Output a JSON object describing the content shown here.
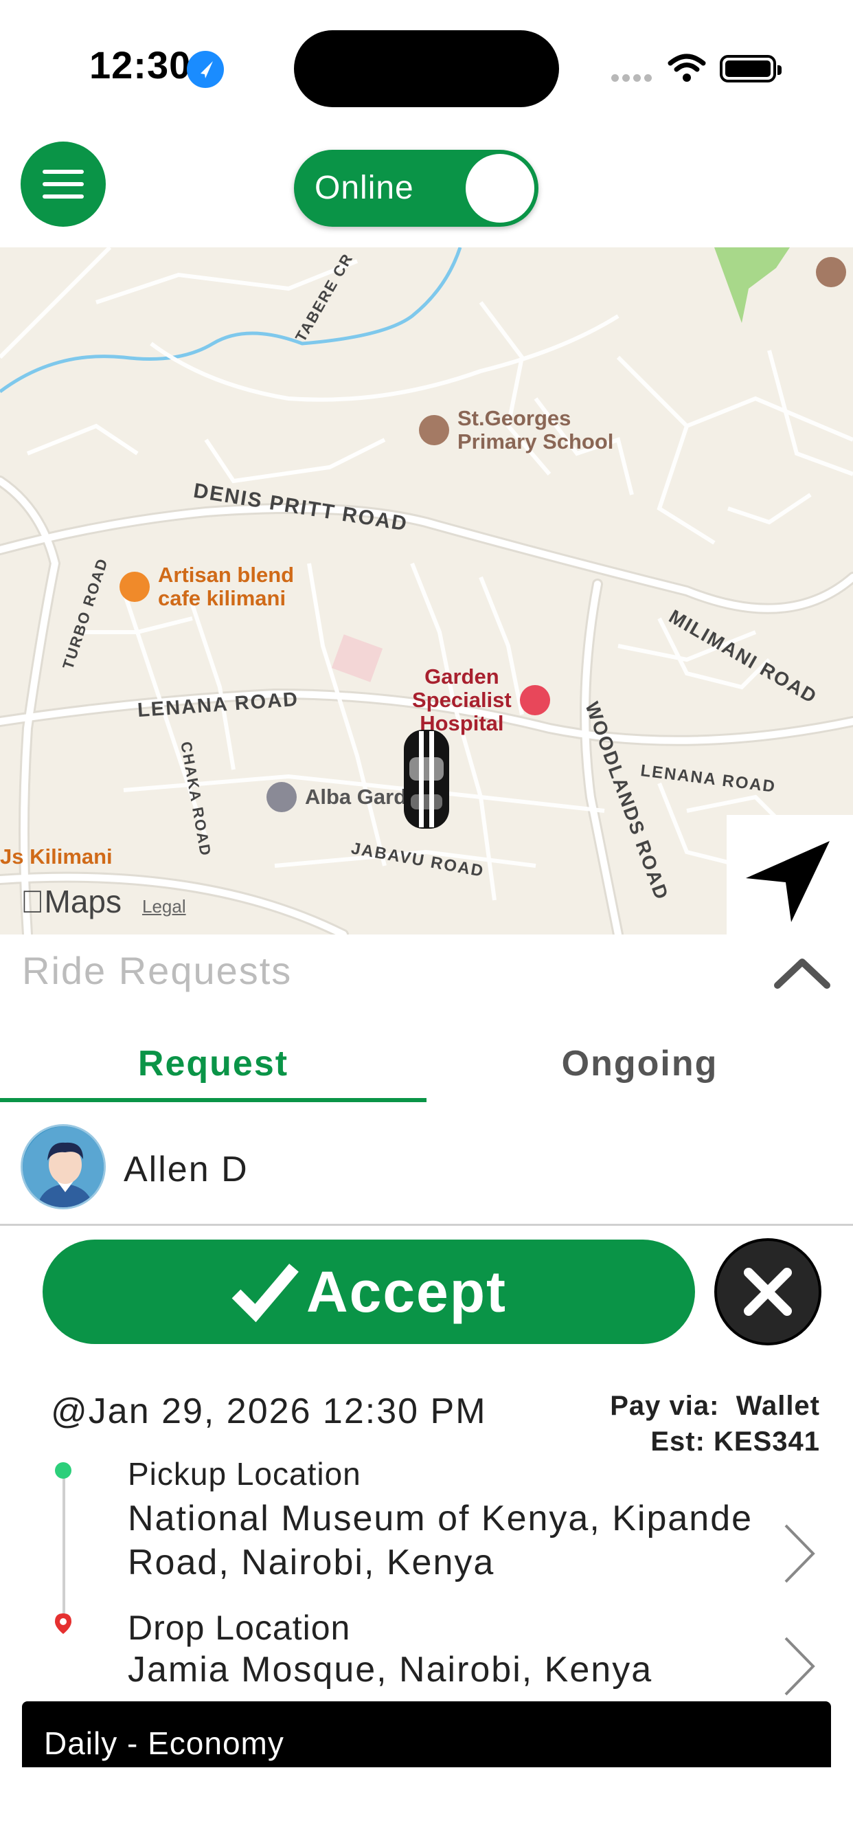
{
  "status_bar": {
    "time": "12:30",
    "location_icon": "location-arrow-icon",
    "signal_icon": "cellular-signal-icon",
    "wifi_icon": "wifi-icon",
    "battery_icon": "battery-icon"
  },
  "header": {
    "menu_icon": "hamburger-menu-icon",
    "status_toggle": {
      "label": "Online",
      "on": true
    }
  },
  "map": {
    "pois": {
      "school": "St.Georges\nPrimary School",
      "cafe": "Artisan blend\ncafe kilimani",
      "hospital": "Garden\nSpecialist\nHospital",
      "garden": "Alba Garden",
      "js": "Js Kilimani"
    },
    "roads": {
      "denis_pritt": "DENIS PRITT ROAD",
      "lenana": "LENANA ROAD",
      "lenana_east": "LENANA ROAD",
      "milimani": "MILIMANI ROAD",
      "woodlands": "WOODLANDS ROAD",
      "turbo": "TURBO ROAD",
      "chaka": "CHAKA ROAD",
      "jabavu": "JABAVU ROAD",
      "tabere": "TABERE CR"
    },
    "attribution": {
      "logo": "Maps",
      "legal": "Legal"
    },
    "recenter_icon": "navigation-arrow-icon",
    "vehicle_icon": "car-icon"
  },
  "sheet": {
    "title": "Ride Requests",
    "collapse_icon": "chevron-up-icon",
    "tabs": [
      {
        "label": "Request",
        "active": true
      },
      {
        "label": "Ongoing",
        "active": false
      }
    ],
    "rider": {
      "name": "Allen D",
      "avatar_icon": "user-avatar-icon"
    },
    "accept_label": "Accept",
    "reject_icon": "close-icon",
    "request": {
      "date": "@Jan 29, 2026 12:30 PM",
      "pay_via": "Pay via:  Wallet",
      "estimate": "Est: KES341",
      "pickup_label": "Pickup Location",
      "pickup_address": "National Museum of Kenya, Kipande Road, Nairobi, Kenya",
      "drop_label": "Drop Location",
      "drop_address": "Jamia Mosque, Nairobi, Kenya",
      "ride_type": "Daily - Economy"
    }
  },
  "colors": {
    "primary_green": "#0a9447",
    "pickup_dot": "#2ccf7a",
    "drop_pin": "#e53030"
  }
}
